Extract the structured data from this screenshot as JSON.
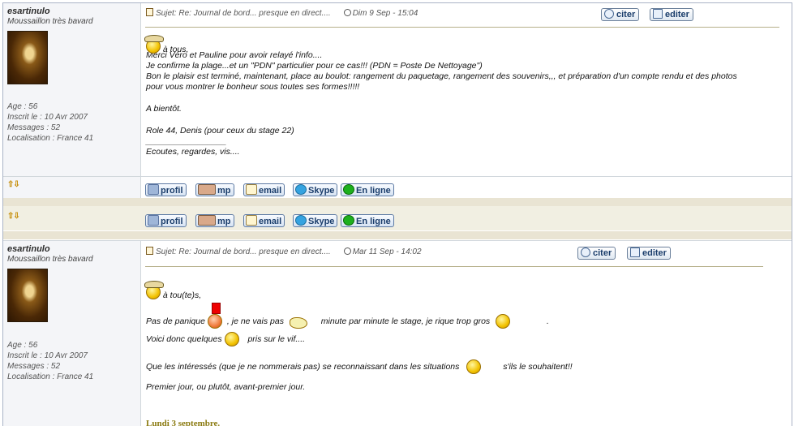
{
  "posts": [
    {
      "author": "esartinulo",
      "rank": "Moussaillon très bavard",
      "age": "Age : 56",
      "joined": "Inscrit le : 10 Avr 2007",
      "messages": "Messages : 52",
      "location": "Localisation : France 41",
      "subject": "Sujet: Re: Journal de bord... presque en direct....",
      "date": "Dim 9 Sep - 15:04",
      "quote_label": "citer",
      "edit_label": "editer",
      "lines": [
        "à tous,",
        "Merci Véro et Pauline pour avoir relayé l'info....",
        "Je confirme la plage...et un \"PDN\" particulier pour ce cas!!! (PDN = Poste De Nettoyage\")",
        "Bon le plaisir est terminé, maintenant, place au boulot: rangement du paquetage, rangement des souvenirs,,, et préparation d'un compte rendu et des photos",
        "pour vous montrer le bonheur sous toutes ses formes!!!!!",
        "A bientôt.",
        "Role 44, Denis (pour ceux du stage 22)",
        "_________________",
        "Ecoutes, regardes, vis...."
      ]
    },
    {
      "author": "esartinulo",
      "rank": "Moussaillon très bavard",
      "age": "Age : 56",
      "joined": "Inscrit le : 10 Avr 2007",
      "messages": "Messages : 52",
      "location": "Localisation : France 41",
      "subject": "Sujet: Re: Journal de bord... presque en direct....",
      "date": "Mar 11 Sep - 14:02",
      "quote_label": "citer",
      "edit_label": "editer",
      "line_greet": "à tou(te)s,",
      "line_panic_a": "Pas de panique",
      "line_panic_b": ", je ne vais pas",
      "line_panic_c": "minute par minute le stage, je rique trop gros",
      "line_panic_d": ".",
      "line_voici_a": "Voici donc quelques",
      "line_voici_b": "pris sur le vif....",
      "line_interest_a": "Que les intéressés (que je ne nommerais pas) se reconnaissant dans les situations",
      "line_interest_b": "s'ils le souhaitent!!",
      "line_first": "Premier jour, ou plutôt, avant-premier jour.",
      "date_heading": "Lundi 3 septembre."
    }
  ],
  "profile_buttons": {
    "profil": "profil",
    "mp": "mp",
    "email": "email",
    "skype": "Skype",
    "online": "En ligne"
  },
  "arrows": "⇧⇩"
}
